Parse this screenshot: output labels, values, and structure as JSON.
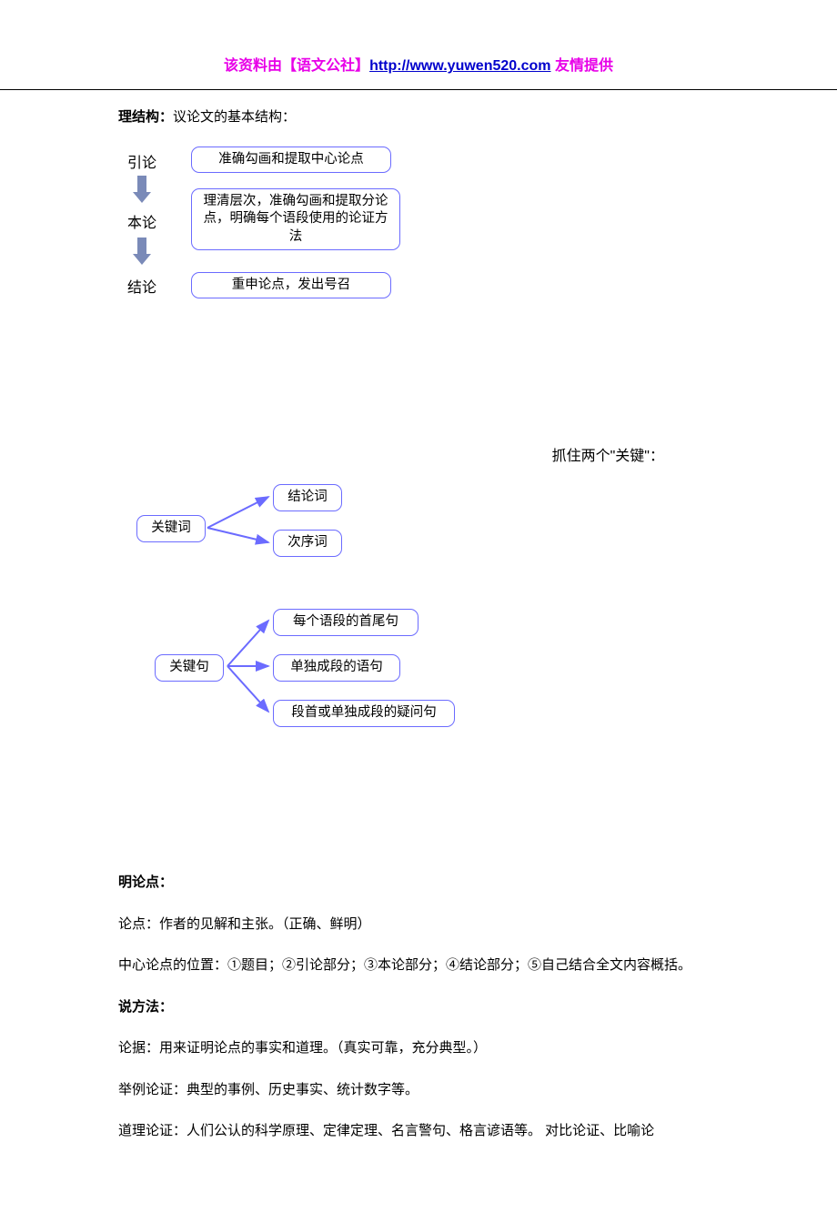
{
  "header": {
    "prefix": "该资料由【语文公社】",
    "link_text": "http://www.yuwen520.com",
    "suffix": " 友情提供"
  },
  "section1": {
    "title_bold": "理结构：",
    "title_rest": "议论文的基本结构：",
    "stages": {
      "s1": "引论",
      "s2": "本论",
      "s3": "结论"
    },
    "boxes": {
      "b1": "准确勾画和提取中心论点",
      "b2": "理清层次，准确勾画和提取分论点，明确每个语段使用的论证方法",
      "b3": "重申论点，发出号召"
    }
  },
  "section2": {
    "caption": "抓住两个\"关键\"：",
    "left": {
      "kw": "关键词",
      "ks": "关键句"
    },
    "right": {
      "r1": "结论词",
      "r2": "次序词",
      "r3": "每个语段的首尾句",
      "r4": "单独成段的语句",
      "r5": "段首或单独成段的疑问句"
    }
  },
  "bodytext": {
    "h1": "明论点：",
    "p1": "论点：作者的见解和主张。（正确、鲜明）",
    "p2": "中心论点的位置：①题目；②引论部分；③本论部分；④结论部分；⑤自己结合全文内容概括。",
    "h2": "说方法：",
    "p3": "论据：用来证明论点的事实和道理。（真实可靠，充分典型。）",
    "p4": "举例论证：典型的事例、历史事实、统计数字等。",
    "p5": "道理论证：人们公认的科学原理、定律定理、名言警句、格言谚语等。 对比论证、比喻论"
  }
}
